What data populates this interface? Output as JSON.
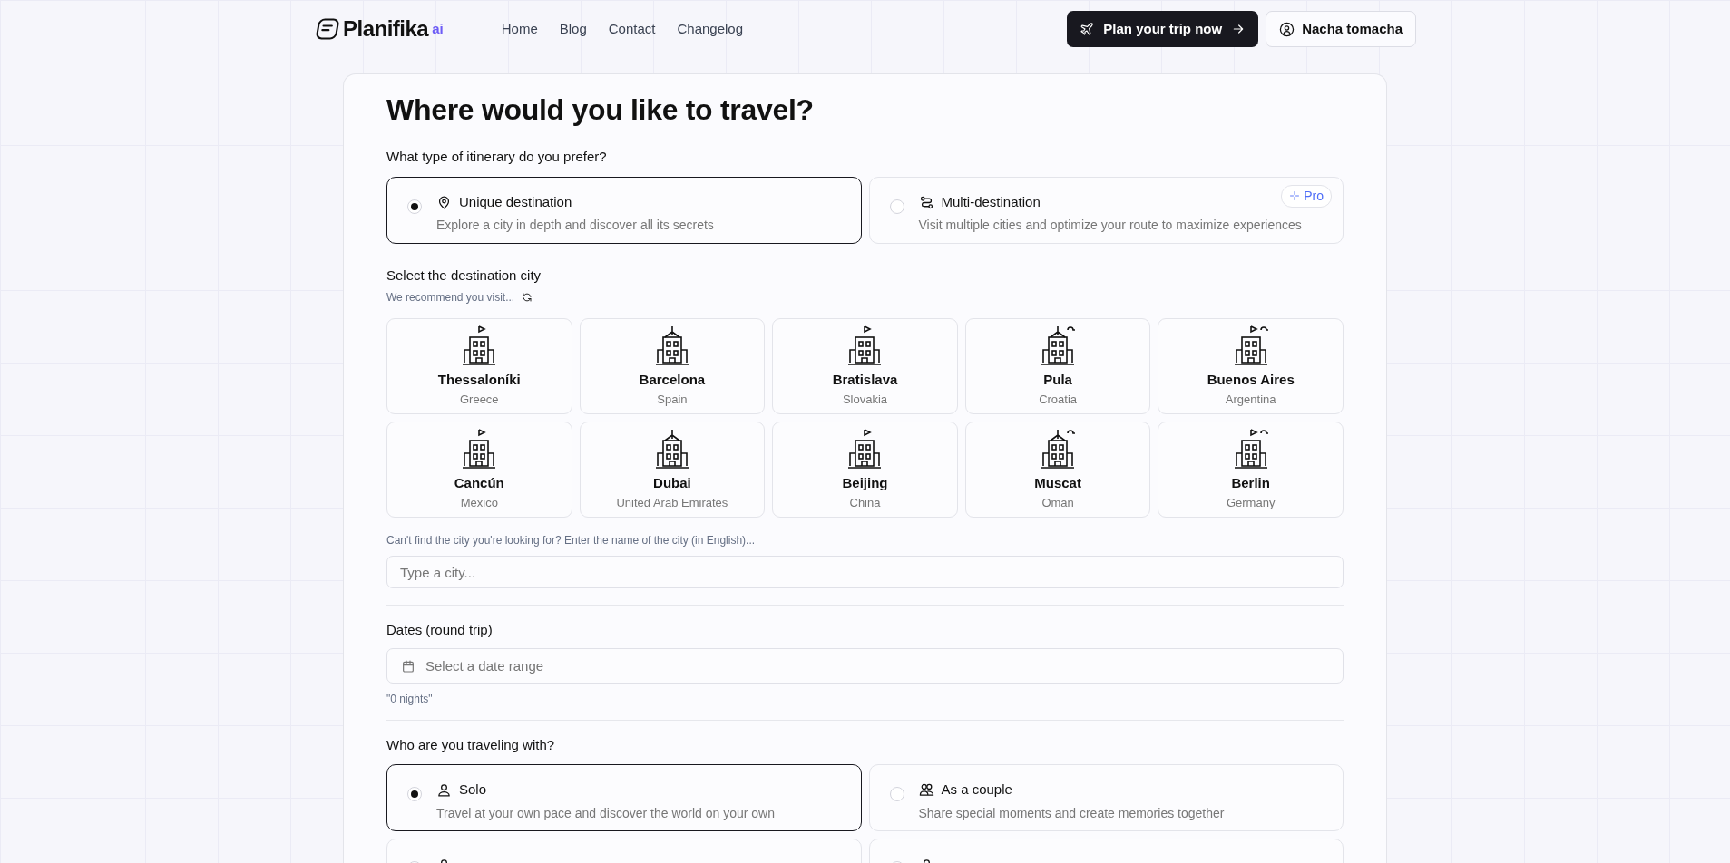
{
  "header": {
    "logo": "Planifika",
    "logo_sup": "ai",
    "nav": [
      "Home",
      "Blog",
      "Contact",
      "Changelog"
    ],
    "cta": "Plan your trip now",
    "user": "Nacha tomacha"
  },
  "title": "Where would you like to travel?",
  "itinerary": {
    "label": "What type of itinerary do you prefer?",
    "options": [
      {
        "kind": "pin",
        "title": "Unique destination",
        "desc": "Explore a city in depth and discover all its secrets",
        "selected": true
      },
      {
        "kind": "route",
        "title": "Multi-destination",
        "desc": "Visit multiple cities and optimize your route to maximize experiences",
        "selected": false,
        "badge": "Pro"
      }
    ]
  },
  "destination": {
    "label": "Select the destination city",
    "recommend": "We recommend you visit...",
    "cities": [
      {
        "name": "Thessaloníki",
        "country": "Greece"
      },
      {
        "name": "Barcelona",
        "country": "Spain"
      },
      {
        "name": "Bratislava",
        "country": "Slovakia"
      },
      {
        "name": "Pula",
        "country": "Croatia"
      },
      {
        "name": "Buenos Aires",
        "country": "Argentina"
      },
      {
        "name": "Cancún",
        "country": "Mexico"
      },
      {
        "name": "Dubai",
        "country": "United Arab Emirates"
      },
      {
        "name": "Beijing",
        "country": "China"
      },
      {
        "name": "Muscat",
        "country": "Oman"
      },
      {
        "name": "Berlin",
        "country": "Germany"
      }
    ],
    "hint": "Can't find the city you're looking for? Enter the name of the city (in English)...",
    "placeholder": "Type a city..."
  },
  "dates": {
    "label": "Dates (round trip)",
    "placeholder": "Select a date range",
    "nights": "\"0 nights\""
  },
  "companions": {
    "label": "Who are you traveling with?",
    "options": [
      {
        "kind": "person",
        "title": "Solo",
        "desc": "Travel at your own pace and discover the world on your own",
        "selected": true
      },
      {
        "kind": "couple",
        "title": "As a couple",
        "desc": "Share special moments and create memories together",
        "selected": false
      },
      {
        "kind": "person",
        "selected": false
      },
      {
        "kind": "person",
        "selected": false
      }
    ]
  }
}
